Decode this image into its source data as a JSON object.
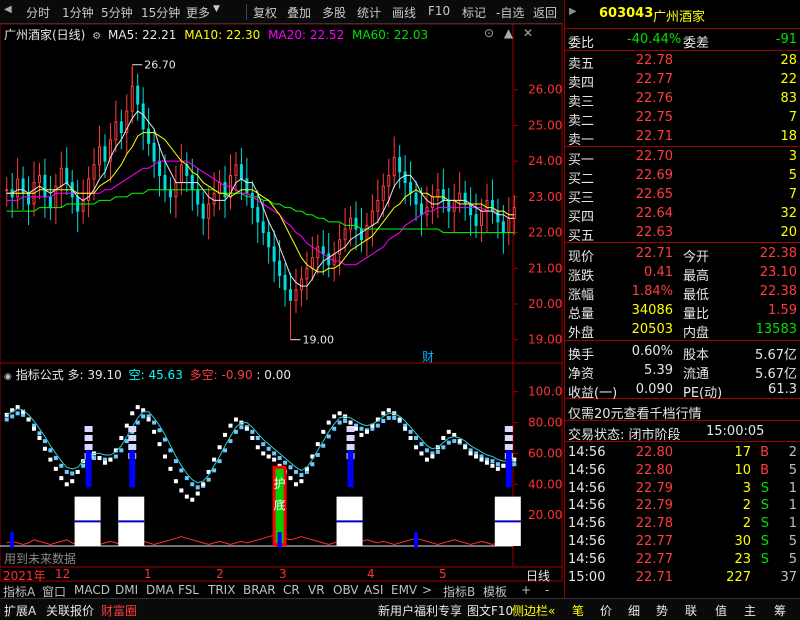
{
  "toolbar": {
    "periods": [
      "分时",
      "1分钟",
      "5分钟",
      "15分钟",
      "更多"
    ],
    "tools": [
      "复权",
      "叠加",
      "多股",
      "统计",
      "画线",
      "F10",
      "标记",
      "-自选",
      "返回"
    ]
  },
  "chart_data": [
    {
      "type": "line",
      "title": "广州酒家(日线)",
      "legend": [
        {
          "name": "MA5",
          "value": "22.21",
          "color": "#e6e6e6"
        },
        {
          "name": "MA10",
          "value": "22.30",
          "color": "#ffff00"
        },
        {
          "name": "MA20",
          "value": "22.52",
          "color": "#ff00ff"
        },
        {
          "name": "MA60",
          "value": "22.03",
          "color": "#00ff00"
        }
      ],
      "y_ticks": [
        "26.00",
        "25.00",
        "24.00",
        "23.00",
        "22.00",
        "21.00",
        "20.00",
        "19.00"
      ],
      "ylim": [
        18.6,
        27.0
      ],
      "annotations": {
        "high": "26.70",
        "low": "19.00",
        "marker": "财"
      },
      "close": [
        23.2,
        23.0,
        23.5,
        23.1,
        22.8,
        23.4,
        23.6,
        23.0,
        22.7,
        23.3,
        23.8,
        23.4,
        23.0,
        22.6,
        22.9,
        23.5,
        23.9,
        24.4,
        24.0,
        24.6,
        25.1,
        24.8,
        25.4,
        26.1,
        25.6,
        24.9,
        24.5,
        24.0,
        23.6,
        23.2,
        23.0,
        23.4,
        23.9,
        23.6,
        23.2,
        22.8,
        22.4,
        22.8,
        23.1,
        23.4,
        23.0,
        23.6,
        23.9,
        23.5,
        23.1,
        22.7,
        22.3,
        22.0,
        21.6,
        21.2,
        20.8,
        20.4,
        20.1,
        20.4,
        20.7,
        21.0,
        21.3,
        21.6,
        21.4,
        21.1,
        21.4,
        21.8,
        22.1,
        22.4,
        22.1,
        21.8,
        22.2,
        22.6,
        22.9,
        23.3,
        23.6,
        24.1,
        23.7,
        23.4,
        23.1,
        22.8,
        22.5,
        22.7,
        23.0,
        23.2,
        22.9,
        22.6,
        22.9,
        23.1,
        22.8,
        22.5,
        22.2,
        22.6,
        22.9,
        22.6,
        22.3,
        22.0,
        22.4,
        22.7
      ],
      "ma5": [
        23.1,
        23.1,
        23.2,
        23.2,
        23.1,
        23.2,
        23.3,
        23.2,
        23.1,
        23.2,
        23.3,
        23.4,
        23.2,
        23.0,
        22.9,
        23.0,
        23.2,
        23.5,
        23.7,
        24.1,
        24.4,
        24.6,
        24.9,
        25.2,
        25.4,
        25.3,
        25.1,
        24.9,
        24.4,
        24.0,
        23.7,
        23.4,
        23.4,
        23.4,
        23.4,
        23.4,
        23.2,
        23.0,
        22.9,
        22.9,
        22.9,
        23.1,
        23.4,
        23.5,
        23.4,
        23.4,
        23.1,
        22.7,
        22.3,
        22.0,
        21.6,
        21.2,
        20.8,
        20.6,
        20.5,
        20.5,
        20.7,
        21.0,
        21.2,
        21.3,
        21.4,
        21.5,
        21.6,
        21.8,
        21.9,
        22.0,
        22.1,
        22.2,
        22.3,
        22.6,
        22.9,
        23.3,
        23.5,
        23.6,
        23.6,
        23.4,
        23.1,
        22.9,
        22.8,
        22.8,
        22.9,
        22.9,
        22.9,
        22.9,
        22.9,
        22.8,
        22.7,
        22.6,
        22.6,
        22.6,
        22.5,
        22.5,
        22.4,
        22.4
      ],
      "ma10": [
        23.1,
        23.1,
        23.1,
        23.1,
        23.1,
        23.1,
        23.2,
        23.2,
        23.2,
        23.2,
        23.2,
        23.2,
        23.2,
        23.1,
        23.1,
        23.1,
        23.1,
        23.3,
        23.4,
        23.5,
        23.7,
        23.9,
        24.2,
        24.4,
        24.7,
        24.8,
        24.8,
        24.8,
        24.7,
        24.6,
        24.4,
        24.2,
        24.0,
        23.9,
        23.7,
        23.6,
        23.4,
        23.3,
        23.2,
        23.1,
        23.1,
        23.0,
        23.1,
        23.2,
        23.2,
        23.2,
        23.1,
        23.0,
        22.9,
        22.7,
        22.5,
        22.2,
        21.9,
        21.6,
        21.3,
        21.1,
        21.0,
        20.9,
        20.9,
        21.0,
        21.0,
        21.1,
        21.3,
        21.5,
        21.6,
        21.7,
        21.8,
        21.9,
        22.1,
        22.3,
        22.5,
        22.7,
        22.8,
        23.0,
        23.1,
        23.2,
        23.1,
        23.1,
        23.0,
        23.0,
        23.0,
        22.9,
        22.9,
        22.8,
        22.8,
        22.8,
        22.8,
        22.8,
        22.7,
        22.7,
        22.6,
        22.6,
        22.5,
        22.5
      ],
      "ma20": [
        22.9,
        22.9,
        22.9,
        23.0,
        23.0,
        23.0,
        23.0,
        23.0,
        23.0,
        23.1,
        23.1,
        23.1,
        23.1,
        23.1,
        23.1,
        23.1,
        23.1,
        23.1,
        23.2,
        23.2,
        23.3,
        23.4,
        23.5,
        23.6,
        23.7,
        23.8,
        23.8,
        23.9,
        24.0,
        24.0,
        24.0,
        24.0,
        24.0,
        24.0,
        23.9,
        23.8,
        23.7,
        23.6,
        23.5,
        23.4,
        23.3,
        23.3,
        23.2,
        23.1,
        23.1,
        23.0,
        22.9,
        22.8,
        22.7,
        22.6,
        22.5,
        22.3,
        22.2,
        22.0,
        21.9,
        21.7,
        21.6,
        21.5,
        21.4,
        21.3,
        21.2,
        21.2,
        21.1,
        21.1,
        21.1,
        21.2,
        21.3,
        21.4,
        21.5,
        21.6,
        21.8,
        21.9,
        22.0,
        22.2,
        22.3,
        22.4,
        22.5,
        22.6,
        22.6,
        22.7,
        22.7,
        22.7,
        22.7,
        22.7,
        22.7,
        22.7,
        22.7,
        22.7,
        22.6,
        22.6,
        22.6,
        22.6,
        22.5,
        22.5
      ],
      "ma60": [
        22.6,
        22.6,
        22.6,
        22.6,
        22.6,
        22.6,
        22.7,
        22.7,
        22.7,
        22.7,
        22.7,
        22.8,
        22.8,
        22.8,
        22.8,
        22.8,
        22.8,
        22.9,
        22.9,
        22.9,
        23.0,
        23.0,
        23.0,
        23.1,
        23.1,
        23.1,
        23.2,
        23.2,
        23.2,
        23.2,
        23.2,
        23.2,
        23.2,
        23.2,
        23.2,
        23.2,
        23.2,
        23.2,
        23.2,
        23.1,
        23.1,
        23.1,
        23.1,
        23.1,
        23.0,
        23.0,
        23.0,
        22.9,
        22.9,
        22.8,
        22.8,
        22.7,
        22.7,
        22.6,
        22.6,
        22.5,
        22.5,
        22.4,
        22.4,
        22.3,
        22.3,
        22.3,
        22.2,
        22.2,
        22.2,
        22.1,
        22.1,
        22.1,
        22.1,
        22.1,
        22.1,
        22.1,
        22.1,
        22.1,
        22.1,
        22.1,
        22.1,
        22.1,
        22.1,
        22.1,
        22.0,
        22.0,
        22.0,
        22.0,
        22.0,
        22.0,
        22.0,
        22.0,
        22.0,
        22.0,
        22.0,
        22.0,
        22.0,
        22.0
      ]
    },
    {
      "type": "line",
      "title": "指标公式",
      "legend": [
        {
          "name": "多",
          "value": "39.10",
          "color": "#e6e6e6"
        },
        {
          "name": "空",
          "value": "45.63",
          "color": "#00ffff"
        },
        {
          "name": "多空",
          "value": "-0.90",
          "color": "#ff3030"
        },
        {
          "name": "",
          "value": ": 0.00",
          "color": "#e6e6e6"
        }
      ],
      "y_ticks": [
        "100.0",
        "80.00",
        "60.00",
        "40.00",
        "20.00"
      ],
      "ylim": [
        0,
        105
      ],
      "bottom_note": "用到未来数据",
      "marker_text": [
        "护",
        "底"
      ],
      "duo": [
        85,
        88,
        90,
        87,
        82,
        76,
        70,
        63,
        56,
        50,
        44,
        40,
        42,
        48,
        55,
        58,
        60,
        57,
        54,
        56,
        62,
        70,
        78,
        86,
        90,
        88,
        82,
        74,
        66,
        58,
        50,
        42,
        36,
        32,
        30,
        34,
        40,
        48,
        56,
        64,
        72,
        78,
        82,
        80,
        76,
        70,
        64,
        60,
        58,
        56,
        52,
        48,
        44,
        40,
        42,
        50,
        58,
        66,
        74,
        80,
        84,
        86,
        84,
        80,
        76,
        72,
        74,
        78,
        82,
        86,
        88,
        86,
        82,
        76,
        70,
        64,
        60,
        56,
        58,
        64,
        70,
        74,
        72,
        68,
        64,
        60,
        58,
        56,
        54,
        52,
        50,
        52,
        54,
        56
      ],
      "kong": [
        82,
        84,
        86,
        85,
        82,
        78,
        73,
        68,
        62,
        57,
        52,
        48,
        47,
        48,
        52,
        55,
        57,
        57,
        56,
        56,
        58,
        62,
        68,
        74,
        80,
        84,
        84,
        80,
        75,
        69,
        62,
        55,
        49,
        44,
        40,
        38,
        39,
        43,
        49,
        55,
        62,
        68,
        74,
        77,
        77,
        74,
        70,
        66,
        63,
        60,
        57,
        54,
        51,
        48,
        46,
        48,
        53,
        59,
        65,
        71,
        76,
        80,
        81,
        80,
        78,
        76,
        75,
        76,
        78,
        81,
        83,
        83,
        81,
        78,
        74,
        70,
        66,
        62,
        60,
        61,
        64,
        67,
        68,
        67,
        65,
        62,
        60,
        58,
        56,
        55,
        53,
        52,
        52,
        53
      ],
      "duokong": [
        2,
        3,
        2,
        1,
        2,
        4,
        3,
        2,
        1,
        2,
        3,
        4,
        2,
        1,
        2,
        3,
        2,
        1,
        2,
        3,
        2,
        1,
        2,
        3,
        4,
        3,
        2,
        1,
        2,
        3,
        4,
        5,
        6,
        5,
        4,
        3,
        2,
        1,
        2,
        3,
        2,
        1,
        2,
        3,
        2,
        3,
        4,
        5,
        6,
        7,
        6,
        5,
        4,
        5,
        6,
        5,
        4,
        3,
        2,
        1,
        2,
        3,
        2,
        1,
        2,
        3,
        4,
        3,
        2,
        3,
        2,
        1,
        2,
        3,
        4,
        5,
        4,
        3,
        2,
        1,
        2,
        3,
        4,
        3,
        2,
        1,
        2,
        3,
        2,
        1,
        2,
        3,
        2,
        1
      ],
      "signals_index": [
        15,
        23,
        63,
        92
      ]
    }
  ],
  "x_axis": {
    "labels": [
      "2021年",
      "12",
      "1",
      "2",
      "3",
      "4",
      "5"
    ],
    "right_label": "日线"
  },
  "tabs": {
    "left": [
      "指标A",
      "窗口",
      "MACD",
      "DMI",
      "DMA",
      "FSL",
      "TRIX",
      "BRAR",
      "CR",
      "VR",
      "OBV",
      "ASI",
      "EMV",
      ">"
    ],
    "right": [
      "指标B",
      "模板",
      "+",
      "-"
    ]
  },
  "stock": {
    "code": "603043",
    "name": "广州酒家"
  },
  "quote": {
    "weibi": {
      "label": "委比",
      "value": "-40.44%",
      "label2": "委差",
      "value2": "-91"
    },
    "asks": [
      {
        "label": "卖五",
        "price": "22.78",
        "vol": "28"
      },
      {
        "label": "卖四",
        "price": "22.77",
        "vol": "22"
      },
      {
        "label": "卖三",
        "price": "22.76",
        "vol": "83"
      },
      {
        "label": "卖二",
        "price": "22.75",
        "vol": "7"
      },
      {
        "label": "卖一",
        "price": "22.71",
        "vol": "18"
      }
    ],
    "bids": [
      {
        "label": "买一",
        "price": "22.70",
        "vol": "3"
      },
      {
        "label": "买二",
        "price": "22.69",
        "vol": "5"
      },
      {
        "label": "买三",
        "price": "22.65",
        "vol": "7"
      },
      {
        "label": "买四",
        "price": "22.64",
        "vol": "32"
      },
      {
        "label": "买五",
        "price": "22.63",
        "vol": "20"
      }
    ],
    "stats": [
      {
        "l1": "现价",
        "v1": "22.71",
        "l2": "今开",
        "v2": "22.38"
      },
      {
        "l1": "涨跌",
        "v1": "0.41",
        "l2": "最高",
        "v2": "23.10"
      },
      {
        "l1": "涨幅",
        "v1": "1.84%",
        "l2": "最低",
        "v2": "22.38"
      },
      {
        "l1": "总量",
        "v1": "34086",
        "l2": "量比",
        "v2": "1.59"
      },
      {
        "l1": "外盘",
        "v1": "20503",
        "l2": "内盘",
        "v2": "13583"
      }
    ],
    "stats2": [
      {
        "l1": "换手",
        "v1": "0.60%",
        "l2": "股本",
        "v2": "5.67亿"
      },
      {
        "l1": "净资",
        "v1": "5.39",
        "l2": "流通",
        "v2": "5.67亿"
      },
      {
        "l1": "收益(一)",
        "v1": "0.090",
        "l2": "PE(动)",
        "v2": "61.3"
      }
    ],
    "promo": "仅需20元查看千档行情",
    "status_label": "交易状态: 闭市阶段",
    "status_time": "15:00:05",
    "trades": [
      {
        "time": "14:56",
        "price": "22.80",
        "vol": "17",
        "bs": "B",
        "n": "2"
      },
      {
        "time": "14:56",
        "price": "22.80",
        "vol": "10",
        "bs": "B",
        "n": "5"
      },
      {
        "time": "14:56",
        "price": "22.79",
        "vol": "3",
        "bs": "S",
        "n": "1"
      },
      {
        "time": "14:56",
        "price": "22.79",
        "vol": "2",
        "bs": "S",
        "n": "1"
      },
      {
        "time": "14:56",
        "price": "22.78",
        "vol": "2",
        "bs": "S",
        "n": "1"
      },
      {
        "time": "14:56",
        "price": "22.77",
        "vol": "30",
        "bs": "S",
        "n": "5"
      },
      {
        "time": "14:56",
        "price": "22.77",
        "vol": "23",
        "bs": "S",
        "n": "5"
      },
      {
        "time": "15:00",
        "price": "22.71",
        "vol": "227",
        "bs": "",
        "n": "37"
      }
    ]
  },
  "bottom_bar": {
    "left": [
      "扩展A",
      "关联报价",
      "财富圈"
    ],
    "right": [
      "新用户福利专享",
      "图文F10",
      "侧边栏«"
    ],
    "side_tabs": [
      "笔",
      "价",
      "细",
      "势",
      "联",
      "值",
      "主",
      "筹"
    ]
  },
  "colors": {
    "up": "#ff3c3c",
    "down": "#00e000",
    "grid": "#a00000",
    "accent": "#ffff00"
  }
}
